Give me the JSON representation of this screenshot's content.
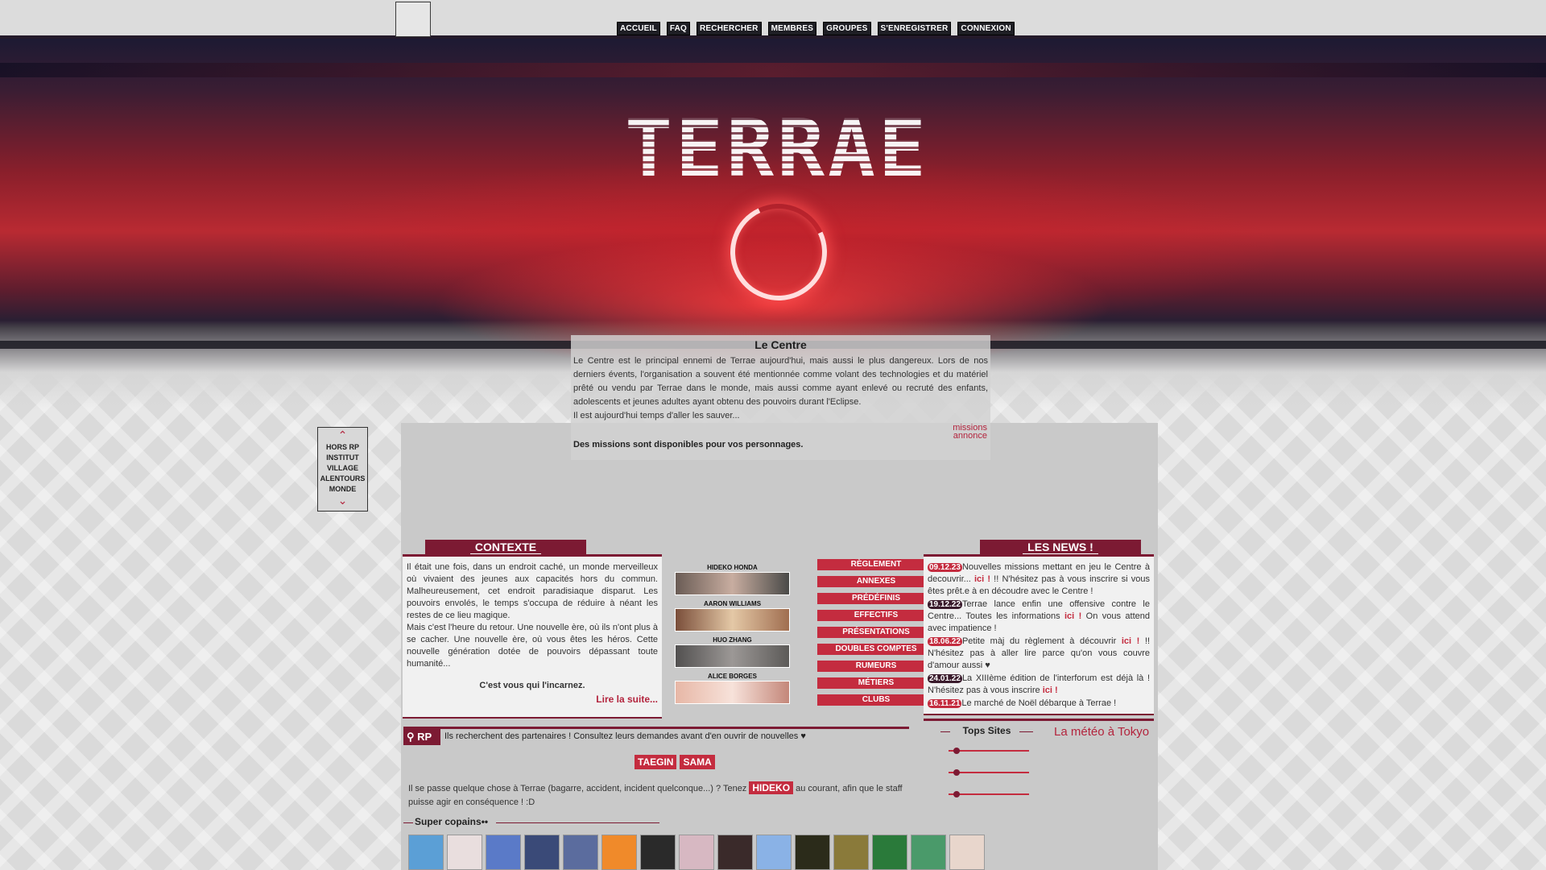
{
  "topnav": {
    "items": [
      "ACCUEIL",
      "FAQ",
      "RECHERCHER",
      "MEMBRES",
      "GROUPES",
      "S'ENREGISTRER",
      "CONNEXION"
    ]
  },
  "banner": {
    "title": "TERRAE",
    "colors": {
      "sky_dark": "#1d1a33",
      "sky_red": "#b92a32",
      "ring": "#ffdede"
    }
  },
  "centre": {
    "heading": "Le Centre",
    "body": "Le Centre est le principal ennemi de Terrae aujourd'hui, mais aussi le plus dangereux. Lors de nos derniers évents, l'organisation a souvent été mentionnée comme volant des technologies et du matériel prêté ou vendu par Terrae dans le monde, mais aussi comme ayant enlevé ou recruté des enfants, adolescents et jeunes adultes ayant obtenu des pouvoirs durant l'Eclipse.",
    "body2": "Il est aujourd'hui temps d'aller les sauver...",
    "link_missions": "missions",
    "link_annonce": "annonce",
    "missions_note": "Des missions sont disponibles pour vos personnages."
  },
  "side_nav": {
    "up_icon": "chevron-up-icon",
    "down_icon": "chevron-down-icon",
    "items": [
      "HORS RP",
      "INSTITUT",
      "VILLAGE",
      "ALENTOURS",
      "MONDE"
    ]
  },
  "contexte": {
    "title": "CONTEXTE",
    "p1": "Il était une fois, dans un endroit caché, un monde merveilleux où vivaient des jeunes aux capacités hors du commun. Malheureusement, cet endroit paradisiaque disparut. Les pouvoirs envolés, le temps s'occupa de réduire à néant les restes de ce lieu magique.",
    "p2": "Mais c'est l'heure du retour. Une nouvelle ère, où ils n'ont plus à se cacher. Une nouvelle ère, où vous êtes les héros. Cette nouvelle génération dotée de pouvoirs dépassant toute humanité...",
    "question": "C'est vous qui l'incarnez.",
    "read_more": "Lire la suite..."
  },
  "characters": [
    {
      "name": "HIDEKO HONDA",
      "color": "#8c7a6e"
    },
    {
      "name": "AARON WILLIAMS",
      "color": "#c8a788"
    },
    {
      "name": "HUO ZHANG",
      "color": "#6e6a68"
    },
    {
      "name": "ALICE BORGES",
      "color": "#e9c0b2"
    }
  ],
  "menu": [
    "RÈGLEMENT",
    "ANNEXES",
    "PRÉDÉFINIS",
    "EFFECTIFS",
    "PRÉSENTATIONS",
    "DOUBLES COMPTES",
    "RUMEURS",
    "MÉTIERS",
    "CLUBS"
  ],
  "news": {
    "title": "LES NEWS !",
    "items": [
      {
        "date": "09.12.23",
        "text_a": "Nouvelles missions mettant en jeu le Centre à decouvrir... ",
        "link": "ici !",
        "text_b": " !! N'hésitez pas à vous inscrire si vous êtes prêt.e à en découdre avec le Centre !"
      },
      {
        "date": "19.12.22",
        "text_a": "Terrae lance enfin une offensive contre le Centre... Toutes les informations ",
        "link": "ici !",
        "text_b": " On vous attend avec impatience !"
      },
      {
        "date": "18.06.22",
        "text_a": "Petite màj du règlement à découvrir ",
        "link": "ici !",
        "text_b": " !! N'hésitez pas à aller lire parce qu'on vous couvre d'amour aussi ♥"
      },
      {
        "date": "24.01.22",
        "text_a": "La XIIIème édition de l'interforum est déjà là ! N'hésitez pas à vous inscrire ",
        "link": "ici !",
        "text_b": ""
      },
      {
        "date": "16.11.21",
        "text_a": "Le marché de Noël débarque à Terrae !",
        "link": "",
        "text_b": ""
      }
    ]
  },
  "rp": {
    "label": "RP",
    "icon": "search-icon",
    "text": "Ils recherchent des partenaires ! Consultez leurs demandes avant d'en ouvrir de nouvelles ♥",
    "tags": [
      "TAEGIN",
      "SAMA"
    ],
    "incident_a": "Il se passe quelque chose à Terrae (bagarre, accident, incident quelconque...) ? Tenez ",
    "incident_tag": "HIDEKO",
    "incident_b": " au courant, afin que le staff puisse agir en conséquence ! :D"
  },
  "copains": {
    "title": "Super copains••",
    "colors": [
      "#5b9fd6",
      "#e9dede",
      "#5a7ac8",
      "#3a4a78",
      "#5b6c9e",
      "#f08a2a",
      "#2a2a2a",
      "#d7b8c2",
      "#3a2a2a",
      "#8ab2e6",
      "#2b2b1a",
      "#8a7a3a",
      "#2a7a3a",
      "#4a9a6a",
      "#e8d6cc"
    ]
  },
  "tops": {
    "title": "Tops Sites",
    "slider_count": 3
  },
  "meteo": "La météo à Tokyo"
}
